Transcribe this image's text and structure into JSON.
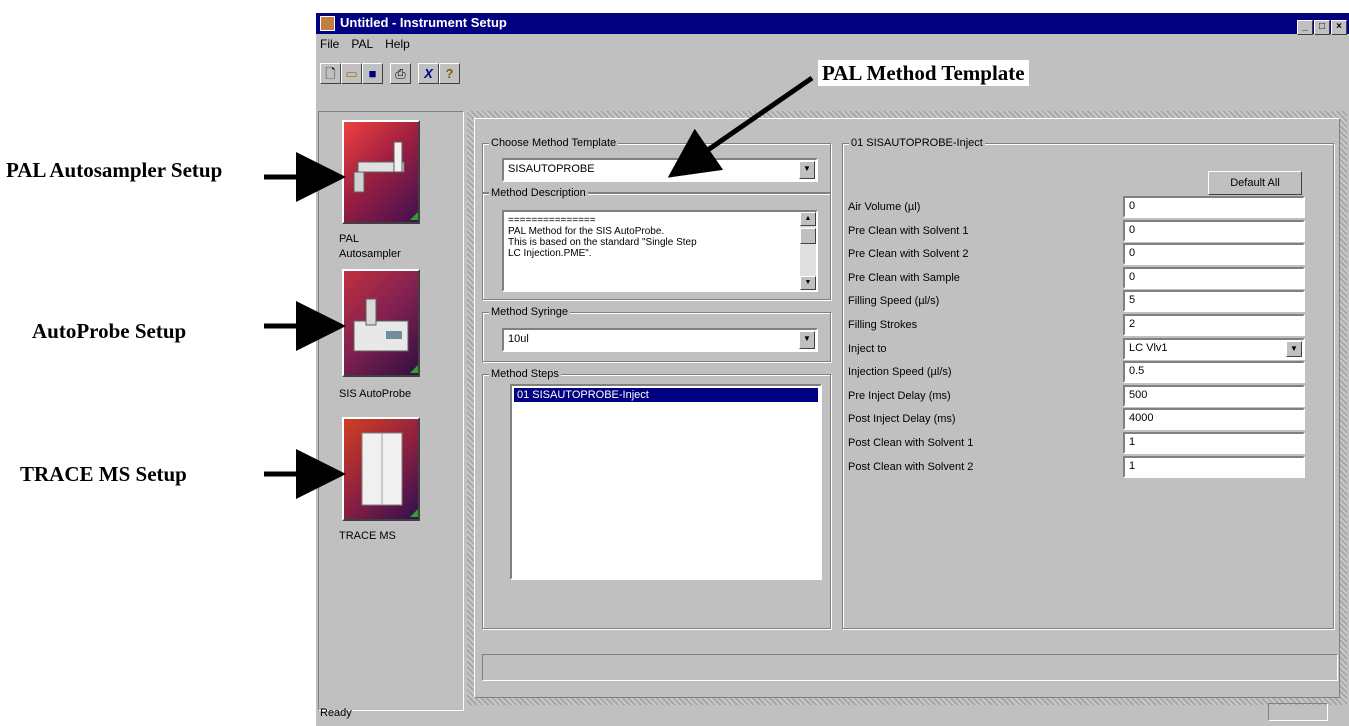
{
  "annotations": {
    "pal_method_template": "PAL Method Template",
    "pal_autosampler_setup": "PAL Autosampler Setup",
    "autoprobe_setup": "AutoProbe Setup",
    "trace_ms_setup": "TRACE MS Setup"
  },
  "window": {
    "title": "Untitled - Instrument Setup",
    "menu": [
      "File",
      "PAL",
      "Help"
    ],
    "status": "Ready"
  },
  "sidebar": {
    "items": [
      {
        "label_line1": "PAL",
        "label_line2": "Autosampler",
        "icon": "pal-autosampler-icon"
      },
      {
        "label": "SIS AutoProbe",
        "icon": "autoprobe-icon"
      },
      {
        "label": "TRACE MS",
        "icon": "trace-ms-icon"
      }
    ]
  },
  "method": {
    "template_group": "Choose Method Template",
    "template_value": "SISAUTOPROBE",
    "description_group": "Method Description",
    "description_lines": [
      "===============",
      "PAL Method for the SIS AutoProbe.",
      "This is based on the standard \"Single Step",
      "LC Injection.PME\"."
    ],
    "syringe_group": "Method Syringe",
    "syringe_value": "10ul",
    "steps_group": "Method Steps",
    "steps": [
      "01 SISAUTOPROBE-Inject"
    ]
  },
  "params": {
    "group": "01 SISAUTOPROBE-Inject",
    "default_all": "Default All",
    "rows": [
      {
        "label": "Air Volume  (µl)",
        "value": "0"
      },
      {
        "label": "Pre Clean with Solvent 1",
        "value": "0"
      },
      {
        "label": "Pre Clean with Solvent 2",
        "value": "0"
      },
      {
        "label": "Pre Clean with Sample",
        "value": "0"
      },
      {
        "label": "Filling Speed  (µl/s)",
        "value": "5"
      },
      {
        "label": "Filling Strokes",
        "value": "2"
      },
      {
        "label": "Inject to",
        "value": "LC Vlv1"
      },
      {
        "label": "Injection Speed  (µl/s)",
        "value": "0.5"
      },
      {
        "label": "Pre Inject Delay  (ms)",
        "value": "500"
      },
      {
        "label": "Post Inject Delay  (ms)",
        "value": "4000"
      },
      {
        "label": "Post Clean with Solvent 1",
        "value": "1"
      },
      {
        "label": "Post Clean with Solvent 2",
        "value": "1"
      }
    ]
  }
}
